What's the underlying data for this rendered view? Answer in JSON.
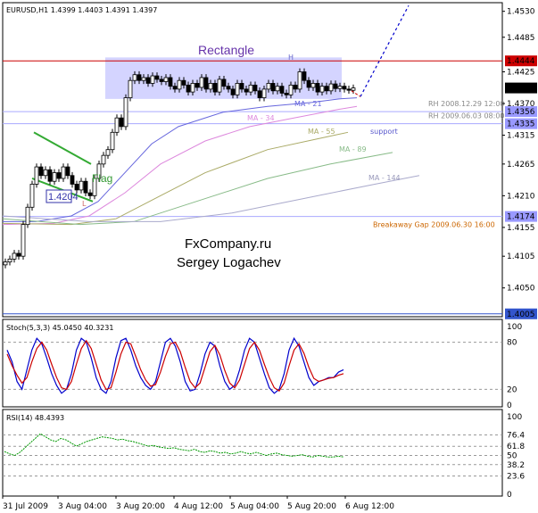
{
  "chart_data": [
    {
      "type": "candlestick",
      "title": "EURUSD,H1  1.4399 1.4403 1.4391 1.4397",
      "y_ticks": [
        "1.4530",
        "1.4485",
        "1.4425",
        "1.4370",
        "1.4315",
        "1.4265",
        "1.4210",
        "1.4155",
        "1.4105",
        "1.4050"
      ],
      "y_tick_values": [
        1.453,
        1.4485,
        1.4425,
        1.437,
        1.4315,
        1.4265,
        1.421,
        1.4155,
        1.4105,
        1.405
      ],
      "ylim": [
        1.4,
        1.4545
      ],
      "x_ticks": [
        "31 Jul 2009",
        "3 Aug 04:00",
        "3 Aug 20:00",
        "4 Aug 12:00",
        "5 Aug 04:00",
        "5 Aug 20:00",
        "6 Aug 12:00"
      ],
      "price_badges": [
        {
          "label": "1.4444",
          "value": 1.4444,
          "color": "#cc0000"
        },
        {
          "label": "1.4397",
          "value": 1.4397,
          "color": "#000000"
        },
        {
          "label": "1.4356",
          "value": 1.4356,
          "color": "#9999ff"
        },
        {
          "label": "1.4335",
          "value": 1.4335,
          "color": "#9999ff"
        },
        {
          "label": "1.4174",
          "value": 1.4174,
          "color": "#9999ff"
        },
        {
          "label": "1.4005",
          "value": 1.4005,
          "color": "#3355cc"
        }
      ],
      "horizontal_lines": [
        {
          "value": 1.4444,
          "color": "#cc0000"
        },
        {
          "value": 1.4356,
          "color": "#aaaaff",
          "label": "RH  2008.12.29 12:00"
        },
        {
          "value": 1.4335,
          "color": "#aaaaff",
          "label": "RH  2009.06.03 08:00"
        },
        {
          "value": 1.4174,
          "color": "#aaaaff",
          "label": "Breakaway Gap 2009.06.30 16:00"
        },
        {
          "value": 1.4005,
          "color": "#3355cc"
        }
      ],
      "annotations": {
        "rectangle": "Rectangle",
        "flag": "Flag",
        "flag_level": "1.4204",
        "high_marker": "H",
        "low_marker": "L",
        "ma21": "MA - 21",
        "ma34": "MA - 34",
        "ma55": "MA - 55",
        "ma89": "MA - 89",
        "ma144": "MA - 144",
        "support": "support",
        "watermark_1": "FxCompany.ru",
        "watermark_2": "Sergey Logachev"
      },
      "colors": {
        "rectangle_fill": "#ccccff",
        "flag_lines": "#33aa33",
        "ma21": "#6666dd",
        "ma34": "#dd88dd",
        "ma55": "#aaaa66",
        "ma89": "#88bb88",
        "ma144": "#aaaacc",
        "forecast": "#0000cc"
      }
    },
    {
      "type": "line",
      "title": "Stoch(5,3,3) 45.0450 40.3231",
      "y_ticks": [
        "100",
        "80",
        "20",
        "0"
      ],
      "y_tick_values": [
        100,
        80,
        20,
        0
      ],
      "ylim": [
        0,
        100
      ],
      "series": [
        {
          "values": [
            70,
            55,
            30,
            20,
            45,
            70,
            85,
            78,
            60,
            40,
            25,
            15,
            20,
            40,
            70,
            85,
            80,
            60,
            35,
            20,
            15,
            30,
            60,
            82,
            85,
            70,
            50,
            35,
            25,
            20,
            30,
            55,
            80,
            85,
            75,
            55,
            30,
            18,
            20,
            40,
            65,
            80,
            75,
            50,
            30,
            20,
            25,
            45,
            70,
            85,
            80,
            60,
            40,
            22,
            15,
            20,
            40,
            70,
            85,
            75,
            55,
            35,
            25,
            30,
            32,
            35,
            35,
            42,
            45
          ]
        },
        {
          "values": [
            65,
            50,
            38,
            28,
            35,
            55,
            72,
            80,
            70,
            52,
            35,
            22,
            20,
            30,
            52,
            72,
            82,
            72,
            52,
            32,
            20,
            22,
            42,
            65,
            80,
            78,
            62,
            45,
            32,
            24,
            26,
            42,
            62,
            78,
            80,
            68,
            48,
            30,
            22,
            28,
            48,
            68,
            76,
            64,
            44,
            28,
            22,
            32,
            52,
            72,
            80,
            70,
            52,
            35,
            22,
            18,
            28,
            50,
            70,
            78,
            66,
            48,
            34,
            30,
            32,
            34,
            35,
            38,
            40
          ]
        }
      ]
    },
    {
      "type": "line",
      "title": "RSI(14) 48.4393",
      "y_ticks": [
        "100",
        "76.4",
        "61.8",
        "50",
        "38.2",
        "23.6",
        "0"
      ],
      "y_tick_values": [
        100,
        76.4,
        61.8,
        50,
        38.2,
        23.6,
        0
      ],
      "ylim": [
        0,
        100
      ],
      "series": [
        {
          "values": [
            55,
            52,
            50,
            54,
            60,
            66,
            72,
            78,
            74,
            70,
            68,
            72,
            70,
            66,
            62,
            65,
            68,
            70,
            72,
            74,
            73,
            72,
            70,
            71,
            69,
            68,
            66,
            64,
            62,
            63,
            61,
            60,
            59,
            60,
            58,
            57,
            56,
            58,
            55,
            54,
            56,
            55,
            53,
            54,
            52,
            53,
            55,
            53,
            52,
            54,
            52,
            50,
            52,
            53,
            51,
            50,
            49,
            50,
            51,
            49,
            48,
            50,
            49,
            48,
            48,
            49,
            48
          ]
        }
      ]
    }
  ]
}
